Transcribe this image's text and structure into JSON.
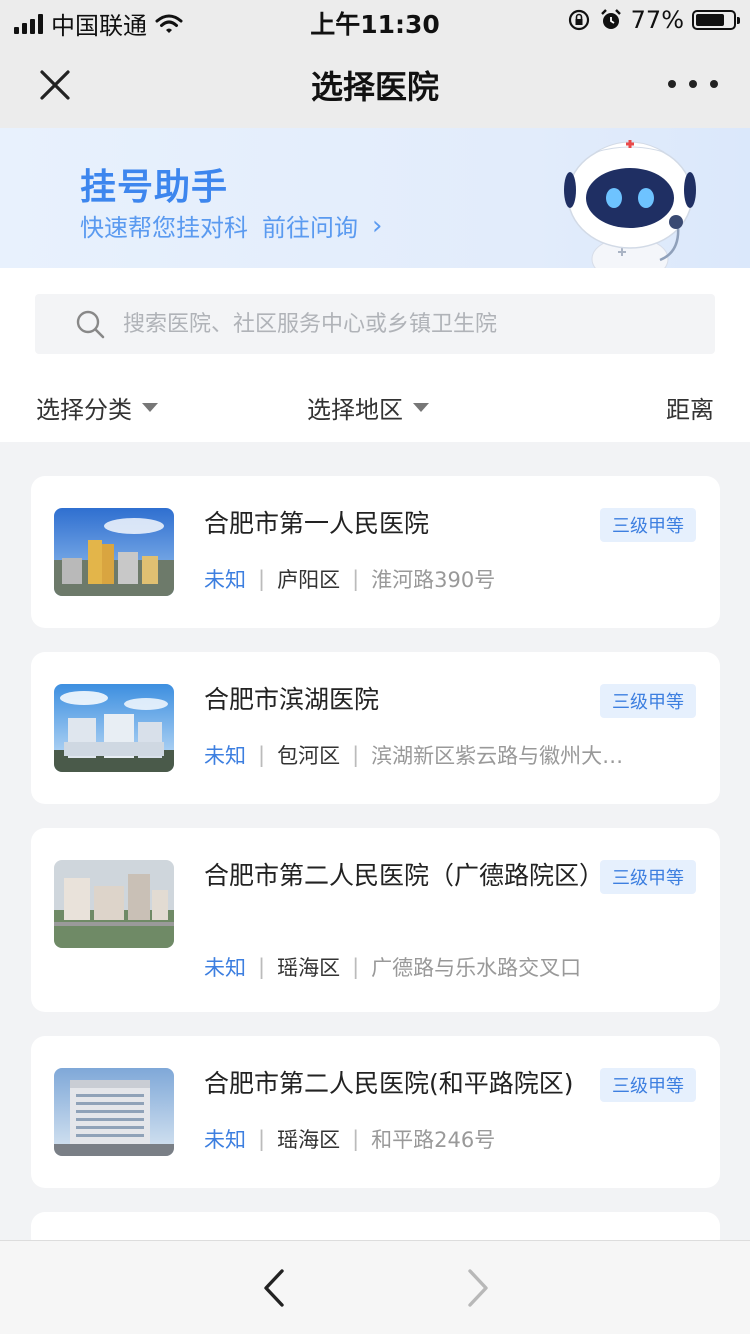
{
  "status_bar": {
    "carrier": "中国联通",
    "time": "上午11:30",
    "battery_percent": "77%",
    "battery_level": 0.77
  },
  "nav": {
    "title": "选择医院"
  },
  "banner": {
    "headline": "挂号助手",
    "subtitle": "快速帮您挂对科",
    "link": "前往问询",
    "arrow": "›"
  },
  "search": {
    "placeholder": "搜索医院、社区服务中心或乡镇卫生院"
  },
  "filters": {
    "category": "选择分类",
    "region": "选择地区",
    "distance": "距离"
  },
  "hospitals": [
    {
      "name": "合肥市第一人民医院",
      "grade": "三级甲等",
      "status": "未知",
      "district": "庐阳区",
      "address": "淮河路390号"
    },
    {
      "name": "合肥市滨湖医院",
      "grade": "三级甲等",
      "status": "未知",
      "district": "包河区",
      "address": "滨湖新区紫云路与徽州大…"
    },
    {
      "name": "合肥市第二人民医院（广德路院区）",
      "grade": "三级甲等",
      "status": "未知",
      "district": "瑶海区",
      "address": "广德路与乐水路交叉口"
    },
    {
      "name": "合肥市第二人民医院(和平路院区)",
      "grade": "三级甲等",
      "status": "未知",
      "district": "瑶海区",
      "address": "和平路246号"
    }
  ],
  "colors": {
    "accent": "#3d86ee",
    "grade_badge_bg": "#e6f0fd",
    "page_bg": "#f2f3f5"
  }
}
